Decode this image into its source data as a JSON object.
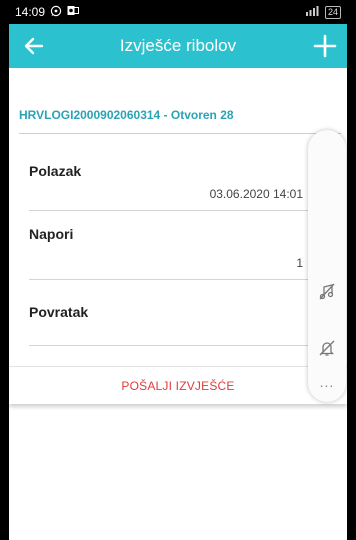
{
  "status_bar": {
    "time": "14:09",
    "battery": "24"
  },
  "app_bar": {
    "title": "Izvješće ribolov"
  },
  "report": {
    "id_status": "HRVLOGI2000902060314 - Otvoren 28"
  },
  "sections": [
    {
      "label": "Polazak",
      "value": "03.06.2020 14:01"
    },
    {
      "label": "Napori",
      "value": "1"
    },
    {
      "label": "Povratak",
      "value": ""
    }
  ],
  "actions": {
    "send_label": "POŠALJI IZVJEŠĆE"
  },
  "side_panel": {
    "more": "..."
  },
  "colors": {
    "app_bar": "#2cc1cf",
    "report_id": "#2aa3b4",
    "send": "#e03b3b"
  },
  "icons": [
    "whatsapp-icon",
    "outlook-icon",
    "signal-icon",
    "back-arrow-icon",
    "plus-icon",
    "music-off-icon",
    "notification-off-icon",
    "edit-icon"
  ]
}
